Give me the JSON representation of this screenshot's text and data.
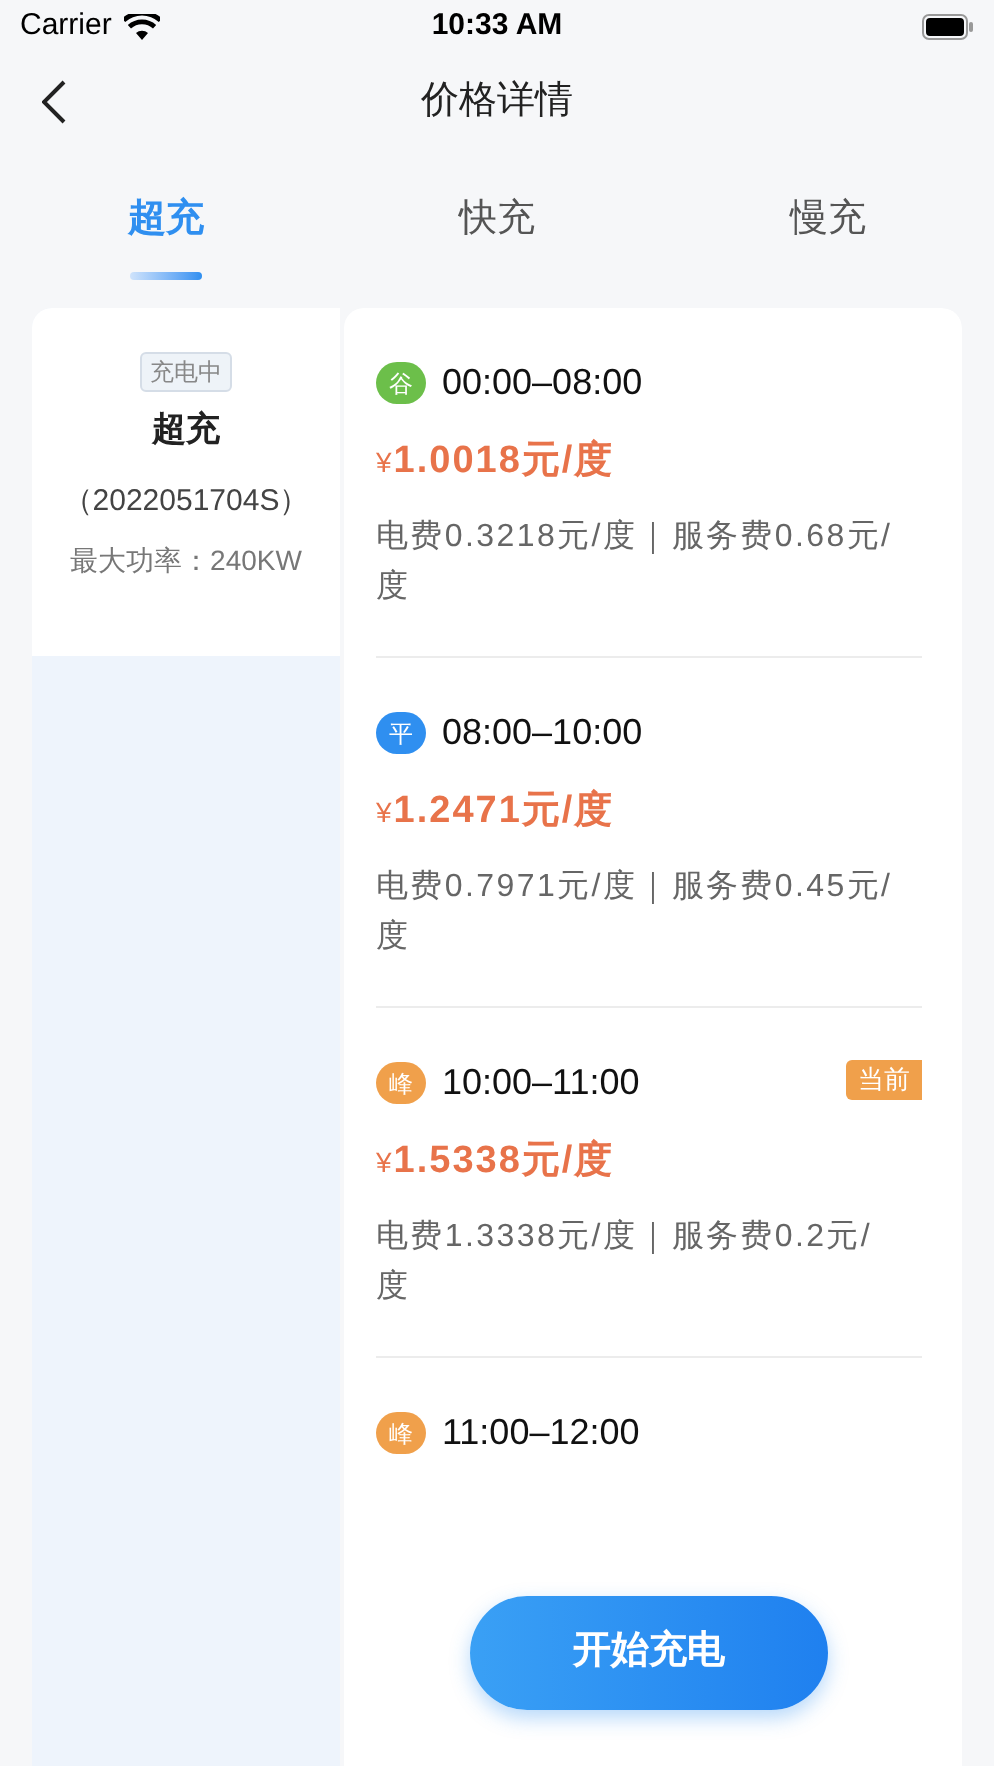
{
  "status_bar": {
    "carrier": "Carrier",
    "time": "10:33 AM"
  },
  "nav": {
    "title": "价格详情"
  },
  "tabs": [
    {
      "label": "超充",
      "selected": true
    },
    {
      "label": "快充",
      "selected": false
    },
    {
      "label": "慢充",
      "selected": false
    }
  ],
  "charger": {
    "status": "充电中",
    "name": "超充",
    "code": "（2022051704S）",
    "power": "最大功率：240KW"
  },
  "current_tag": "当前",
  "periods": [
    {
      "badge": "谷",
      "color": "#6cbf4a",
      "time": "00:00–08:00",
      "currency": "¥",
      "price": "1.0018元/度",
      "detail": "电费0.3218元/度｜服务费0.68元/度",
      "current": false
    },
    {
      "badge": "平",
      "color": "#2f8ff0",
      "time": "08:00–10:00",
      "currency": "¥",
      "price": "1.2471元/度",
      "detail": "电费0.7971元/度｜服务费0.45元/度",
      "current": false
    },
    {
      "badge": "峰",
      "color": "#f0a04b",
      "time": "10:00–11:00",
      "currency": "¥",
      "price": "1.5338元/度",
      "detail": "电费1.3338元/度｜服务费0.2元/度",
      "current": true
    },
    {
      "badge": "峰",
      "color": "#f0a04b",
      "time": "11:00–12:00",
      "current": false
    }
  ],
  "start_button": "开始充电"
}
